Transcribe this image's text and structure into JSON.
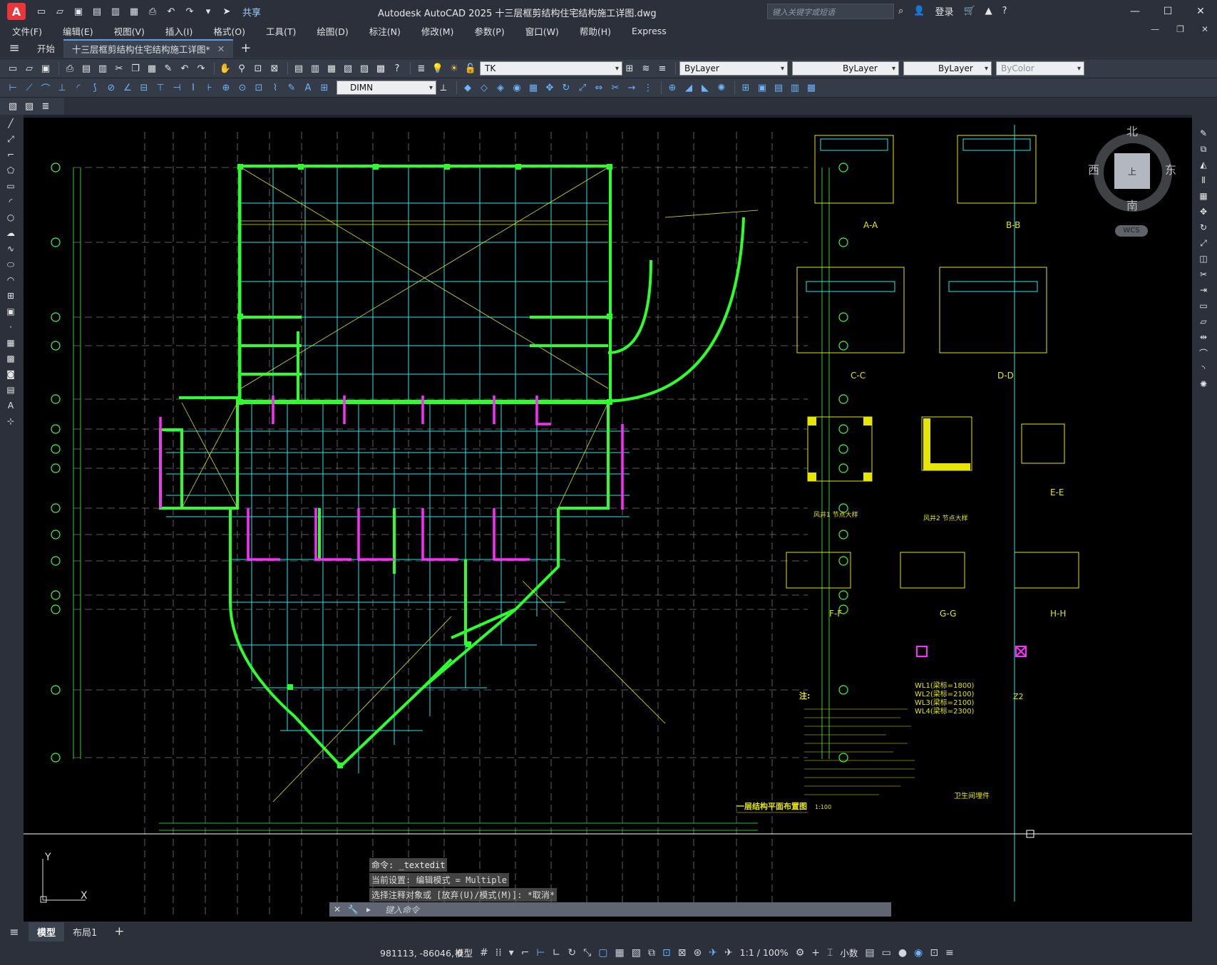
{
  "app": {
    "logo_letter": "A",
    "title": "Autodesk AutoCAD 2025    十三层框剪结构住宅结构施工详图.dwg",
    "share_label": "共享",
    "search_placeholder": "键入关键字或短语",
    "login_label": "登录",
    "accent_color": "#e8363b"
  },
  "menu": {
    "items": [
      "文件(F)",
      "编辑(E)",
      "视图(V)",
      "插入(I)",
      "格式(O)",
      "工具(T)",
      "绘图(D)",
      "标注(N)",
      "修改(M)",
      "参数(P)",
      "窗口(W)",
      "帮助(H)",
      "Express"
    ]
  },
  "tabs": {
    "start_label": "开始",
    "file_tab_label": "十三层框剪结构住宅结构施工详图*"
  },
  "toolbar": {
    "layer_name": "TK",
    "color_value": "ByLayer",
    "linetype_value": "ByLayer",
    "lineweight_value": "ByLayer",
    "plotstyle_value": "ByColor",
    "dimstyle_value": "DIMN"
  },
  "viewcube": {
    "north": "北",
    "south": "南",
    "east": "东",
    "west": "西",
    "face": "上",
    "wcs": "WCS"
  },
  "drawing": {
    "plan_title": "一层结构平面布置图",
    "plan_scale": "1:100",
    "notes_title": "注:",
    "sections": [
      "A-A",
      "B-B",
      "C-C",
      "D-D",
      "E-E",
      "F-F",
      "G-G",
      "H-H"
    ],
    "detail_labels": [
      "风井1 节点大样",
      "风井2 节点大样"
    ],
    "wl_list": [
      "WL1(梁标=1800)",
      "WL2(梁标=2100)",
      "WL3(梁标=2100)",
      "WL4(梁标=2300)"
    ],
    "z2_label": "Z2",
    "embed_title": "卫生间埋件"
  },
  "command": {
    "history": [
      "命令: _textedit",
      "当前设置: 编辑模式 = Multiple",
      "选择注释对象或 [放弃(U)/模式(M)]: *取消*"
    ],
    "placeholder": "键入命令"
  },
  "layout_tabs": {
    "model": "模型",
    "layout1": "布局1"
  },
  "status": {
    "coordinates": "981113, -86046, 0",
    "mode": "模型",
    "scale": "1:1 / 100%",
    "units": "小数"
  }
}
